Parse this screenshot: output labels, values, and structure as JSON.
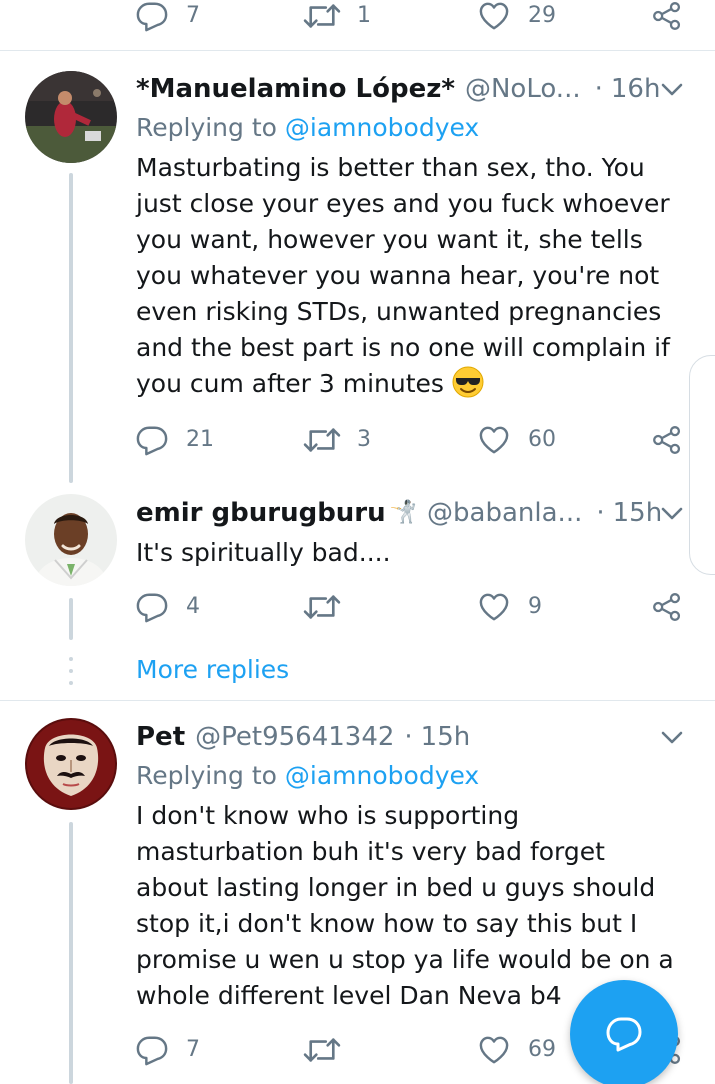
{
  "top_actions": {
    "reply_count": "7",
    "retweet_count": "1",
    "like_count": "29"
  },
  "tweets": [
    {
      "name": "*Manuelamino López*",
      "handle": "@NoLo...",
      "time": "16h",
      "replying_label": "Replying to",
      "replying_handle": "@iamnobodyex",
      "text": "Masturbating is better than sex, tho. You just close your eyes and you fuck whoever you want, however you want it, she tells you whatever you wanna hear, you're not even risking STDs, unwanted pregnancies and the best part is no one will complain if you cum after 3 minutes",
      "emoji": "sunglasses-smiley",
      "reply_count": "21",
      "retweet_count": "3",
      "like_count": "60"
    },
    {
      "name": "emir gburugburu",
      "name_emoji": "🤺",
      "handle": "@babanla...",
      "time": "15h",
      "text": "It's spiritually bad....",
      "reply_count": "4",
      "retweet_count": "",
      "like_count": "9"
    },
    {
      "name": "Pet",
      "handle": "@Pet95641342",
      "time": "15h",
      "replying_label": "Replying to",
      "replying_handle": "@iamnobodyex",
      "text": "I don't know who is supporting masturbation buh it's very bad forget about lasting longer in bed u guys should stop it,i don't know how to say this but I promise u wen u stop ya life would be on a whole different level Dan Neva b4",
      "reply_count": "7",
      "retweet_count": "",
      "like_count": "69"
    }
  ],
  "more_replies": "More replies",
  "dot_separator": "·",
  "colors": {
    "accent": "#1da1f2",
    "muted": "#657786",
    "text": "#14171a",
    "line": "#ccd6dd"
  },
  "icons": [
    "reply-icon",
    "retweet-icon",
    "like-icon",
    "share-icon",
    "caret-down-icon",
    "compose-icon"
  ]
}
